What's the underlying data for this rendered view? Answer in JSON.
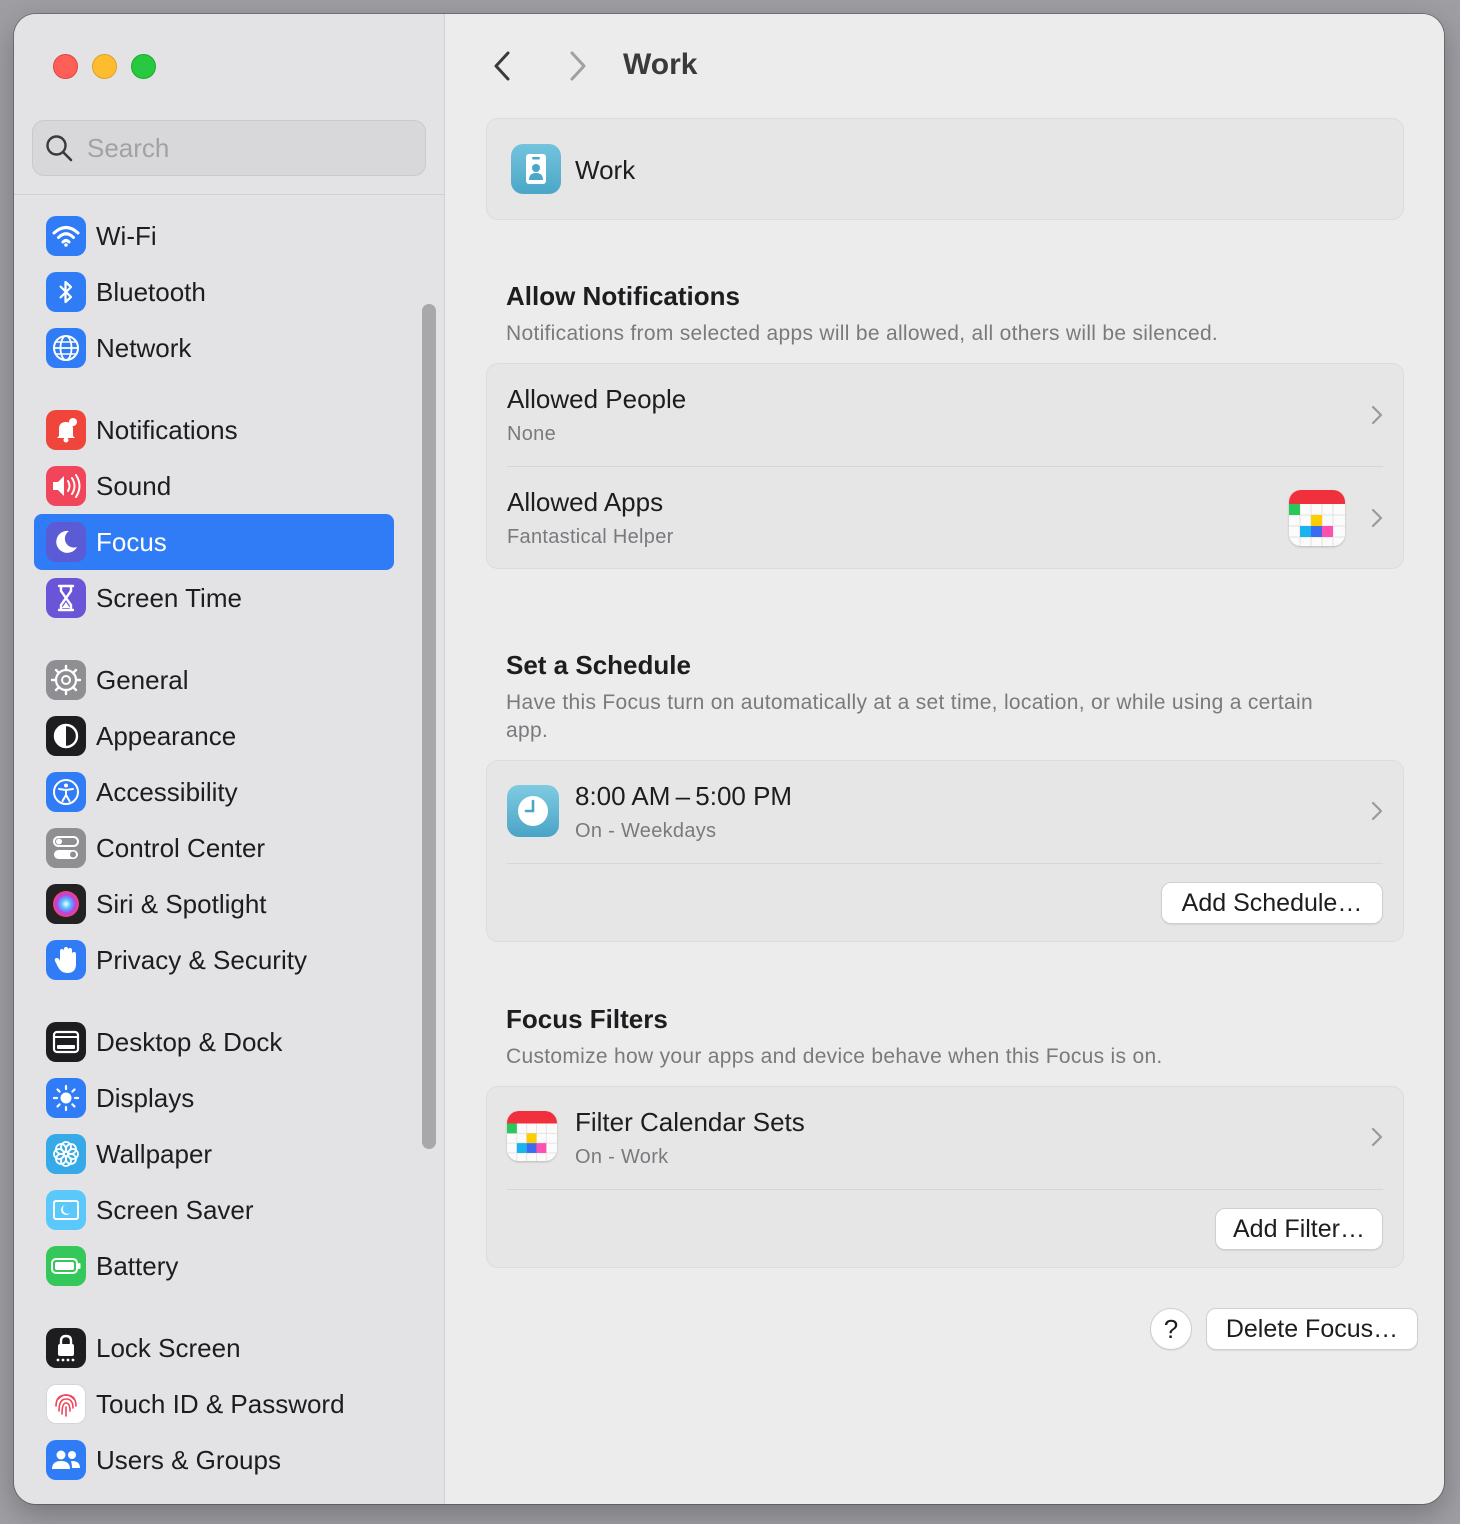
{
  "window": {
    "title": "Work"
  },
  "search": {
    "placeholder": "Search"
  },
  "sidebar": {
    "items": [
      {
        "label": "Wi-Fi",
        "icon": "wifi-icon",
        "color": "#2f7cf6"
      },
      {
        "label": "Bluetooth",
        "icon": "bluetooth-icon",
        "color": "#2f7cf6"
      },
      {
        "label": "Network",
        "icon": "globe-icon",
        "color": "#2f7cf6"
      },
      {
        "label": "Notifications",
        "icon": "bell-icon",
        "color": "#f0453a"
      },
      {
        "label": "Sound",
        "icon": "speaker-icon",
        "color": "#f0455a"
      },
      {
        "label": "Focus",
        "icon": "moon-icon",
        "color": "#5b5bd6"
      },
      {
        "label": "Screen Time",
        "icon": "hourglass-icon",
        "color": "#6a55d8"
      },
      {
        "label": "General",
        "icon": "gear-icon",
        "color": "#8e8e93"
      },
      {
        "label": "Appearance",
        "icon": "appearance-icon",
        "color": "#1d1d1f"
      },
      {
        "label": "Accessibility",
        "icon": "accessibility-icon",
        "color": "#2f7cf6"
      },
      {
        "label": "Control Center",
        "icon": "toggles-icon",
        "color": "#8e8e93"
      },
      {
        "label": "Siri & Spotlight",
        "icon": "siri-icon",
        "color": "#222"
      },
      {
        "label": "Privacy & Security",
        "icon": "hand-icon",
        "color": "#2f7cf6"
      },
      {
        "label": "Desktop & Dock",
        "icon": "dock-icon",
        "color": "#1d1d1f"
      },
      {
        "label": "Displays",
        "icon": "sun-icon",
        "color": "#2f7cf6"
      },
      {
        "label": "Wallpaper",
        "icon": "flower-icon",
        "color": "#36a9e8"
      },
      {
        "label": "Screen Saver",
        "icon": "screensaver-icon",
        "color": "#5ac8fa"
      },
      {
        "label": "Battery",
        "icon": "battery-icon",
        "color": "#34c759"
      },
      {
        "label": "Lock Screen",
        "icon": "lock-icon",
        "color": "#1d1d1f"
      },
      {
        "label": "Touch ID & Password",
        "icon": "fingerprint-icon",
        "color": "#ffffff"
      },
      {
        "label": "Users & Groups",
        "icon": "users-icon",
        "color": "#2f7cf6"
      }
    ],
    "active": "Focus"
  },
  "header": {
    "title": "Work"
  },
  "focus_card": {
    "name": "Work",
    "icon": "badge-icon"
  },
  "allow_notifications": {
    "title": "Allow Notifications",
    "description": "Notifications from selected apps will be allowed, all others will be silenced.",
    "people": {
      "title": "Allowed People",
      "value": "None"
    },
    "apps": {
      "title": "Allowed Apps",
      "value": "Fantastical Helper"
    }
  },
  "schedule": {
    "title": "Set a Schedule",
    "description": "Have this Focus turn on automatically at a set time, location, or while using a certain app.",
    "item": {
      "time": "8:00 AM – 5:00 PM",
      "status": "On - Weekdays"
    },
    "add_label": "Add Schedule…"
  },
  "filters": {
    "title": "Focus Filters",
    "description": "Customize how your apps and device behave when this Focus is on.",
    "item": {
      "title": "Filter Calendar Sets",
      "status": "On - Work"
    },
    "add_label": "Add Filter…"
  },
  "footer": {
    "help_label": "?",
    "delete_label": "Delete Focus…"
  }
}
